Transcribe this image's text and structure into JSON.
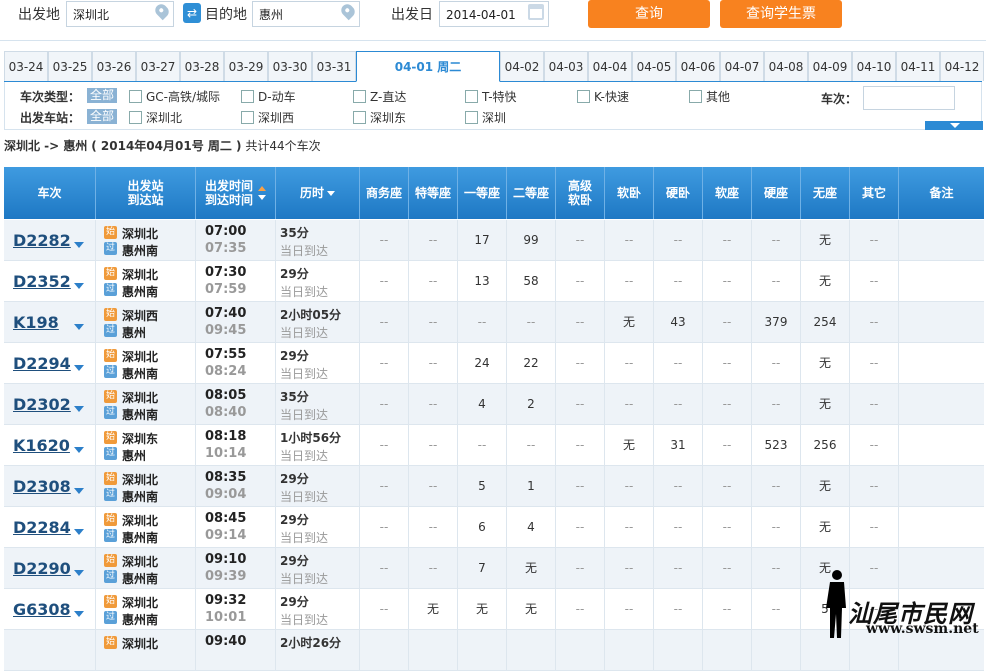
{
  "search": {
    "from_label": "出发地",
    "from_value": "深圳北",
    "to_label": "目的地",
    "to_value": "惠州",
    "date_label": "出发日",
    "date_value": "2014-04-01",
    "query_button": "查询",
    "student_button": "查询学生票"
  },
  "date_tabs": [
    {
      "label": "03-24"
    },
    {
      "label": "03-25"
    },
    {
      "label": "03-26"
    },
    {
      "label": "03-27"
    },
    {
      "label": "03-28"
    },
    {
      "label": "03-29"
    },
    {
      "label": "03-30"
    },
    {
      "label": "03-31"
    },
    {
      "label": "04-01 周二",
      "active": true
    },
    {
      "label": "04-02"
    },
    {
      "label": "04-03"
    },
    {
      "label": "04-04"
    },
    {
      "label": "04-05"
    },
    {
      "label": "04-06"
    },
    {
      "label": "04-07"
    },
    {
      "label": "04-08"
    },
    {
      "label": "04-09"
    },
    {
      "label": "04-10"
    },
    {
      "label": "04-11"
    },
    {
      "label": "04-12"
    }
  ],
  "filters": {
    "type_label": "车次类型：",
    "station_label": "出发车站：",
    "all_label": "全部",
    "train_no_label": "车次：",
    "types": [
      "GC-高铁/城际",
      "D-动车",
      "Z-直达",
      "T-特快",
      "K-快速",
      "其他"
    ],
    "stations": [
      "深圳北",
      "深圳西",
      "深圳东",
      "深圳"
    ]
  },
  "summary": {
    "route": "深圳北 -> 惠州",
    "date": "( 2014年04月01号  周二 )",
    "count": "共计44个车次"
  },
  "table": {
    "headers": {
      "train": "车次",
      "station": "出发站\n到达站",
      "time": "出发时间\n到达时间",
      "duration": "历时",
      "biz": "商务座",
      "special": "特等座",
      "first": "一等座",
      "second": "二等座",
      "soft_sleeper_hi": "高级\n软卧",
      "soft_sleeper": "软卧",
      "hard_sleeper": "硬卧",
      "soft_seat": "软座",
      "hard_seat": "硬座",
      "no_seat": "无座",
      "other": "其它",
      "remark": "备注"
    },
    "start_badge": "始",
    "pass_badge": "过",
    "rows": [
      {
        "no": "D2282",
        "from": "深圳北",
        "to": "惠州南",
        "dep": "07:00",
        "arr": "07:35",
        "dur": "35分",
        "day": "当日到达",
        "seats": [
          "--",
          "--",
          "17",
          "99",
          "--",
          "--",
          "--",
          "--",
          "--",
          "无",
          "--"
        ]
      },
      {
        "no": "D2352",
        "from": "深圳北",
        "to": "惠州南",
        "dep": "07:30",
        "arr": "07:59",
        "dur": "29分",
        "day": "当日到达",
        "seats": [
          "--",
          "--",
          "13",
          "58",
          "--",
          "--",
          "--",
          "--",
          "--",
          "无",
          "--"
        ]
      },
      {
        "no": "K198",
        "from": "深圳西",
        "to": "惠州",
        "dep": "07:40",
        "arr": "09:45",
        "dur": "2小时05分",
        "day": "当日到达",
        "seats": [
          "--",
          "--",
          "--",
          "--",
          "--",
          "无",
          "43",
          "--",
          "379",
          "254",
          "--"
        ]
      },
      {
        "no": "D2294",
        "from": "深圳北",
        "to": "惠州南",
        "dep": "07:55",
        "arr": "08:24",
        "dur": "29分",
        "day": "当日到达",
        "seats": [
          "--",
          "--",
          "24",
          "22",
          "--",
          "--",
          "--",
          "--",
          "--",
          "无",
          "--"
        ]
      },
      {
        "no": "D2302",
        "from": "深圳北",
        "to": "惠州南",
        "dep": "08:05",
        "arr": "08:40",
        "dur": "35分",
        "day": "当日到达",
        "seats": [
          "--",
          "--",
          "4",
          "2",
          "--",
          "--",
          "--",
          "--",
          "--",
          "无",
          "--"
        ]
      },
      {
        "no": "K1620",
        "from": "深圳东",
        "to": "惠州",
        "dep": "08:18",
        "arr": "10:14",
        "dur": "1小时56分",
        "day": "当日到达",
        "seats": [
          "--",
          "--",
          "--",
          "--",
          "--",
          "无",
          "31",
          "--",
          "523",
          "256",
          "--"
        ]
      },
      {
        "no": "D2308",
        "from": "深圳北",
        "to": "惠州南",
        "dep": "08:35",
        "arr": "09:04",
        "dur": "29分",
        "day": "当日到达",
        "seats": [
          "--",
          "--",
          "5",
          "1",
          "--",
          "--",
          "--",
          "--",
          "--",
          "无",
          "--"
        ]
      },
      {
        "no": "D2284",
        "from": "深圳北",
        "to": "惠州南",
        "dep": "08:45",
        "arr": "09:14",
        "dur": "29分",
        "day": "当日到达",
        "seats": [
          "--",
          "--",
          "6",
          "4",
          "--",
          "--",
          "--",
          "--",
          "--",
          "无",
          "--"
        ]
      },
      {
        "no": "D2290",
        "from": "深圳北",
        "to": "惠州南",
        "dep": "09:10",
        "arr": "09:39",
        "dur": "29分",
        "day": "当日到达",
        "seats": [
          "--",
          "--",
          "7",
          "无",
          "--",
          "--",
          "--",
          "--",
          "--",
          "无",
          "--"
        ]
      },
      {
        "no": "G6308",
        "from": "深圳北",
        "to": "惠州南",
        "dep": "09:32",
        "arr": "10:01",
        "dur": "29分",
        "day": "当日到达",
        "seats": [
          "--",
          "无",
          "无",
          "无",
          "--",
          "--",
          "--",
          "--",
          "--",
          "5",
          "--"
        ]
      },
      {
        "no": "",
        "from": "深圳北",
        "to": "",
        "dep": "09:40",
        "arr": "",
        "dur": "2小时26分",
        "day": "",
        "seats": [
          "",
          "",
          "",
          "",
          "",
          "",
          "",
          "",
          "",
          "",
          ""
        ]
      }
    ]
  },
  "watermark": {
    "text": "汕尾市民网",
    "url": "www.swsm.net"
  },
  "colors": {
    "accent_blue": "#2c8ad4",
    "orange_button": "#f8821f",
    "header_blue": "#1e78c4"
  }
}
